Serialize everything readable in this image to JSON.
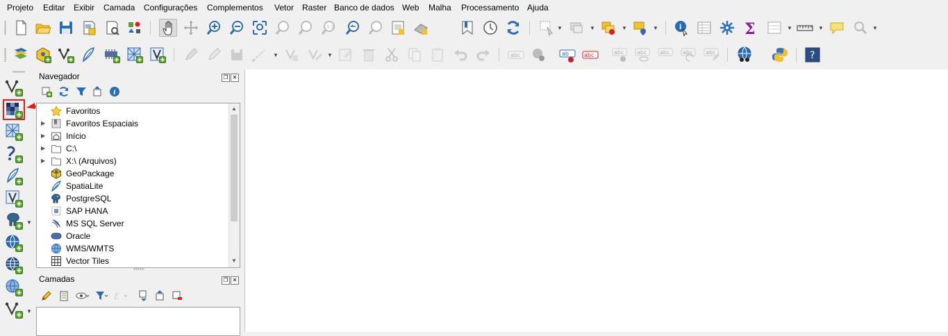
{
  "menu": [
    "Projeto",
    "Editar",
    "Exibir",
    "Camada",
    "Configurações",
    "Complementos",
    "Vetor",
    "Raster",
    "Banco de dados",
    "Web",
    "Malha",
    "Processamento",
    "Ajuda"
  ],
  "browser_panel": {
    "title": "Navegador",
    "items": [
      {
        "label": "Favoritos",
        "icon": "star-icon",
        "expandable": false
      },
      {
        "label": "Favoritos Espaciais",
        "icon": "spatial-bookmark-icon",
        "expandable": true
      },
      {
        "label": "Início",
        "icon": "home-folder-icon",
        "expandable": true
      },
      {
        "label": "C:\\",
        "icon": "folder-icon",
        "expandable": true
      },
      {
        "label": "X:\\ (Arquivos)",
        "icon": "folder-icon",
        "expandable": true
      },
      {
        "label": "GeoPackage",
        "icon": "geopackage-icon",
        "expandable": false
      },
      {
        "label": "SpatiaLite",
        "icon": "spatialite-feather-icon",
        "expandable": false
      },
      {
        "label": "PostgreSQL",
        "icon": "postgresql-elephant-icon",
        "expandable": false
      },
      {
        "label": "SAP HANA",
        "icon": "sap-hana-icon",
        "expandable": false
      },
      {
        "label": "MS SQL Server",
        "icon": "mssql-icon",
        "expandable": false
      },
      {
        "label": "Oracle",
        "icon": "oracle-icon",
        "expandable": false
      },
      {
        "label": "WMS/WMTS",
        "icon": "wms-globe-icon",
        "expandable": false
      },
      {
        "label": "Vector Tiles",
        "icon": "vector-tiles-grid-icon",
        "expandable": false
      }
    ]
  },
  "layers_panel": {
    "title": "Camadas"
  },
  "colors": {
    "accent_red": "#e41c1c",
    "qgis_blue": "#2b6bb5",
    "qgis_green": "#5aa02c",
    "qgis_yellow": "#f2c12e"
  }
}
